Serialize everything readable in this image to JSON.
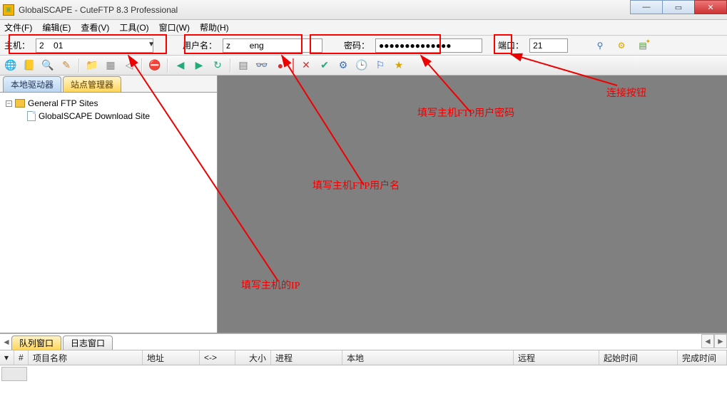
{
  "titlebar": {
    "title": "GlobalSCAPE - CuteFTP 8.3 Professional"
  },
  "menu": {
    "file": "文件(F)",
    "edit": "编辑(E)",
    "view": "查看(V)",
    "tools": "工具(O)",
    "window": "窗口(W)",
    "help": "帮助(H)"
  },
  "conn": {
    "host_label": "主机：",
    "host_value": "2    01",
    "user_label": "用户名：",
    "user_value": "z        eng",
    "pass_label": "密码：",
    "pass_value": "●●●●●●●●●●●●●●",
    "port_label": "端口：",
    "port_value": "21"
  },
  "sidebar": {
    "tab_local": "本地驱动器",
    "tab_sites": "站点管理器",
    "root": "General FTP Sites",
    "child": "GlobalSCAPE Download Site"
  },
  "bottom": {
    "tab_queue": "队列窗口",
    "tab_log": "日志窗口",
    "cols": {
      "num": "#",
      "name": "项目名称",
      "addr": "地址",
      "dir": "<->",
      "size": "大小",
      "proc": "进程",
      "local": "本地",
      "remote": "远程",
      "start": "起始时间",
      "end": "完成时间"
    }
  },
  "annotations": {
    "ip": "填写主机的IP",
    "user": "填写主机FTP用户名",
    "pass": "填写主机FTP用户密码",
    "connect": "连接按钮"
  }
}
